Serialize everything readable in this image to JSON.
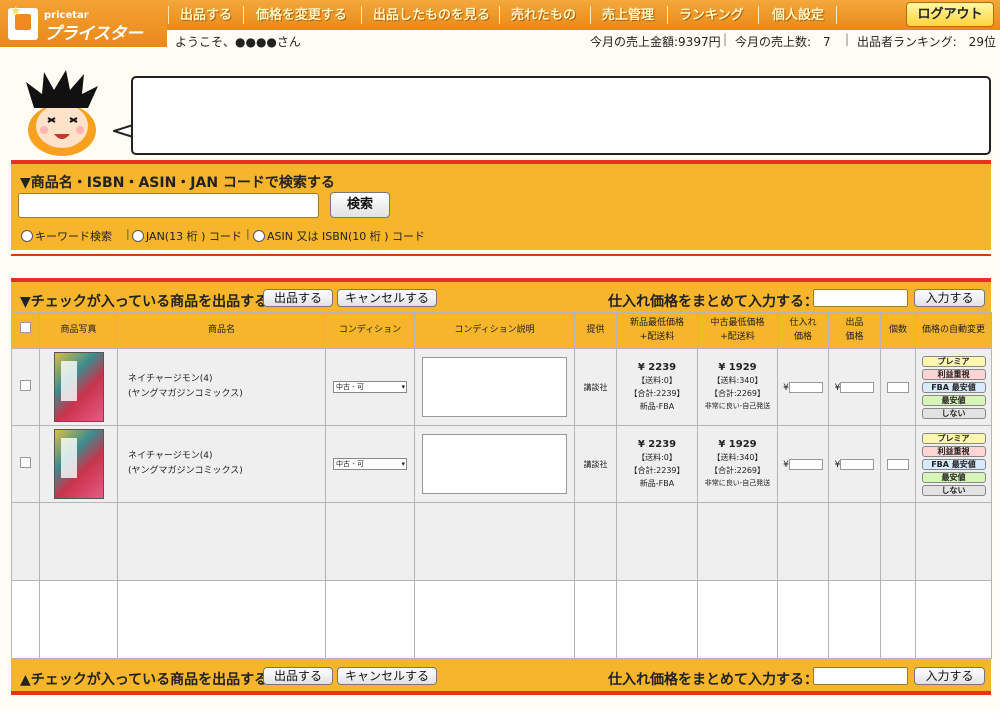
{
  "app": {
    "logo_small": "pricetar",
    "logo_big": "プライスター"
  },
  "nav": {
    "items": [
      "出品する",
      "価格を変更する",
      "出品したものを見る",
      "売れたもの",
      "売上管理",
      "ランキング",
      "個人設定"
    ],
    "logout": "ログアウト"
  },
  "info": {
    "welcome": "ようこそ、●●●●さん",
    "monthly_sales_amount": "今月の売上金額:9397円",
    "monthly_sales_count": "今月の売上数:　7",
    "ranking": "出品者ランキング:　29位"
  },
  "search": {
    "heading": "▼商品名・ISBN・ASIN・JAN コードで検索する",
    "button": "検索",
    "query": "",
    "options": [
      "キーワード検索",
      "JAN(13 桁 ) コード",
      "ASIN 又は ISBN(10 桁 ) コード"
    ]
  },
  "toolbar": {
    "top_text": "▼チェックが入っている商品を出品する：",
    "bottom_text": "▲チェックが入っている商品を出品する：",
    "list_button": "出品する",
    "cancel_button": "キャンセルする",
    "bulk_text": "仕入れ価格をまとめて入力する：",
    "bulk_button": "入力する",
    "bulk_value": ""
  },
  "table": {
    "headers": [
      "商品写真",
      "商品名",
      "コンディション",
      "コンディション説明",
      "提供",
      "新品最低価格\n+配送料",
      "中古最低価格\n+配送料",
      "仕入れ\n価格",
      "出品\n価格",
      "個数",
      "価格の自動変更"
    ],
    "rows": [
      {
        "title": "ネイチャージモン(4)",
        "subtitle": "(ヤングマガジンコミックス)",
        "condition": "中古 - 可",
        "publisher": "講談社",
        "new_price": "¥ 2239",
        "new_shipping": "【送料:0】",
        "new_total": "【合計:2239】",
        "new_type": "新品-FBA",
        "used_price": "¥ 1929",
        "used_shipping": "【送料:340】",
        "used_total": "【合計:2269】",
        "used_type": "非常に良い-自己発送"
      },
      {
        "title": "ネイチャージモン(4)",
        "subtitle": "(ヤングマガジンコミックス)",
        "condition": "中古 - 可",
        "publisher": "講談社",
        "new_price": "¥ 2239",
        "new_shipping": "【送料:0】",
        "new_total": "【合計:2239】",
        "new_type": "新品-FBA",
        "used_price": "¥ 1929",
        "used_shipping": "【送料:340】",
        "used_total": "【合計:2269】",
        "used_type": "非常に良い-自己発送"
      }
    ],
    "yen": "¥",
    "auto_options": [
      "プレミア",
      "利益重視",
      "FBA 最安値",
      "最安値",
      "しない"
    ]
  }
}
